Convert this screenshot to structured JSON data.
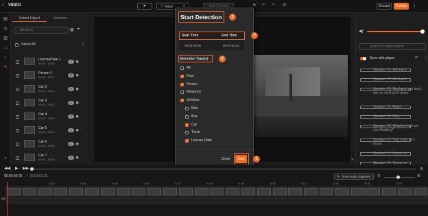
{
  "header": {
    "back_icon": "arrow-left-icon",
    "title": "VIDEO",
    "tool_face": "Face",
    "tool_auto_correct": "Auto Correct",
    "discard": "Discard",
    "publish": "Publish",
    "accent": "#f06a23"
  },
  "left_panel": {
    "tab_detected": "Detect Object",
    "tab_selection": "Selection",
    "search_placeholder": "All Items",
    "select_all": "Select All",
    "items": [
      {
        "name": "LicensePlate 1",
        "time": "00:00 - 00:00",
        "badge": "1"
      },
      {
        "name": "Person 1",
        "time": "00:00 - 00:01",
        "badge": "8"
      },
      {
        "name": "Car 2",
        "time": "00:01 - 00:01",
        "badge": "4"
      },
      {
        "name": "Car 3",
        "time": "00:01 - 00:02",
        "badge": "1"
      },
      {
        "name": "Car 4",
        "time": "00:02 - 00:04",
        "badge": "1"
      },
      {
        "name": "Car 5",
        "time": "00:02 - 00:04",
        "badge": "1"
      },
      {
        "name": "Car 6",
        "time": "00:03 - 00:04",
        "badge": "1"
      },
      {
        "name": "Car 7",
        "time": "00:03 - 00:04",
        "badge": "1"
      }
    ]
  },
  "dialog": {
    "title": "Start Detection",
    "badge_title": "2",
    "start_time_label": "Start Time",
    "end_time_label": "End Time",
    "start_time": "00:00:00:00",
    "end_time": "00:03:52:03",
    "badge_time": "3",
    "types_label": "Detection Type(s)",
    "badge_types": "4",
    "options": [
      {
        "label": "All",
        "checked": false,
        "indent": false
      },
      {
        "label": "Face",
        "checked": true,
        "indent": false
      },
      {
        "label": "Person",
        "checked": true,
        "indent": false
      },
      {
        "label": "Weapons",
        "checked": false,
        "indent": false
      },
      {
        "label": "Vehicles",
        "checked": true,
        "indent": false
      },
      {
        "label": "Bike",
        "checked": false,
        "indent": true
      },
      {
        "label": "Bus",
        "checked": false,
        "indent": true
      },
      {
        "label": "Car",
        "checked": true,
        "indent": true
      },
      {
        "label": "Truck",
        "checked": false,
        "indent": true
      },
      {
        "label": "License Plate",
        "checked": true,
        "indent": true
      }
    ],
    "close": "Close",
    "start": "Start",
    "badge_start": "5"
  },
  "right_panel": {
    "search_placeholder": "Search in transcription",
    "sync_label": "Sync with player",
    "lines": [
      "Speaker #1: Get back.",
      "Speaker #1: Get back.",
      "Speaker #1: Get back, get back, see so we'll put it down.",
      "Speaker #2: Right.",
      "Speaker #1: Play.",
      "Speaker #2: What the hell are you Harding?",
      "Speaker #1: Hey, man, let's move.",
      "Speaker #1: Come on.",
      "Speaker #1: Come on."
    ]
  },
  "timeline": {
    "current_time": "00:00:00:00",
    "total_time": "00:03:52:03",
    "draw_audio_segment": "Draw Audio Segment",
    "ticks": [
      "00:15",
      "00:30",
      "00:45",
      "01:00",
      "01:15",
      "01:30",
      "01:45",
      "02:00",
      "02:15",
      "02:30",
      "02:45",
      "03:00"
    ],
    "track_label": "VIDEO"
  }
}
